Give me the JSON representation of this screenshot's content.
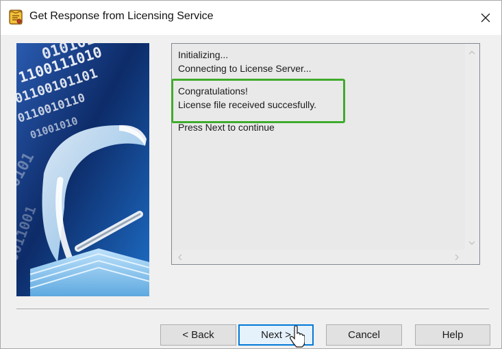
{
  "window": {
    "title": "Get Response from Licensing Service",
    "icon": "scroll-license-icon",
    "close_icon": "close-icon"
  },
  "banner": {
    "image": "binary-data-document-arrow-illustration"
  },
  "log": {
    "lines_top": [
      "Initializing...",
      "Connecting to License Server..."
    ],
    "lines_highlighted": [
      "Congratulations!",
      "License file received succesfully."
    ],
    "lines_bottom": [
      "Press Next to continue"
    ],
    "highlight_color": "#3fab2c"
  },
  "buttons": {
    "back": "< Back",
    "next": "Next >",
    "cancel": "Cancel",
    "help": "Help"
  },
  "colors": {
    "default_button_border": "#0078d7",
    "log_background": "#e9e9e9"
  }
}
